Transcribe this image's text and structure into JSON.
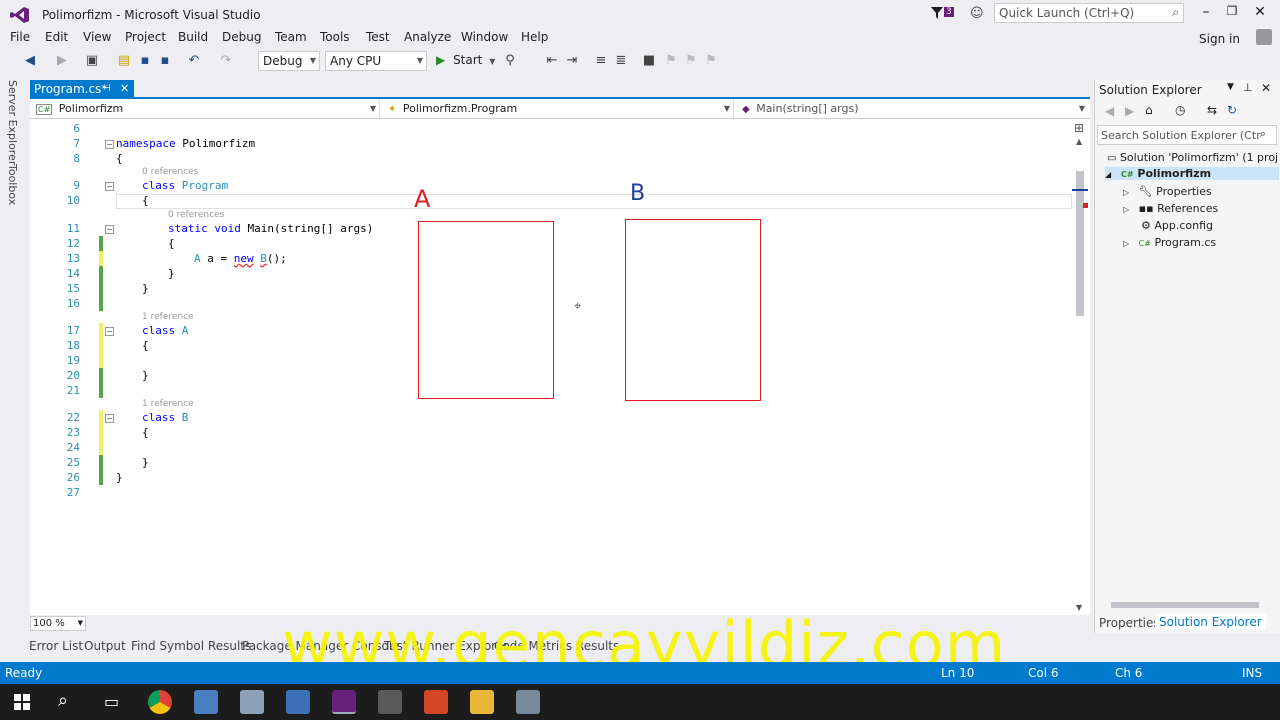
{
  "window": {
    "title": "Polimorfizm - Microsoft Visual Studio",
    "notification_count": "3",
    "quick_launch_placeholder": "Quick Launch (Ctrl+Q)"
  },
  "menu": [
    "File",
    "Edit",
    "View",
    "Project",
    "Build",
    "Debug",
    "Team",
    "Tools",
    "Test",
    "Analyze",
    "Window",
    "Help"
  ],
  "signin": "Sign in",
  "toolbar": {
    "config": "Debug",
    "platform": "Any CPU",
    "start": "Start"
  },
  "left_tabs": [
    "Server Explorer",
    "Toolbox"
  ],
  "document_tab": "Program.cs*",
  "navbar": {
    "project": "Polimorfizm",
    "type": "Polimorfizm.Program",
    "member": "Main(string[] args)"
  },
  "code": {
    "lines": [
      "6",
      "7",
      "8",
      "9",
      "10",
      "11",
      "12",
      "13",
      "14",
      "15",
      "16",
      "17",
      "18",
      "19",
      "20",
      "21",
      "22",
      "23",
      "24",
      "25",
      "26",
      "27"
    ],
    "ns_kw": "namespace",
    "ns_name": "Polimorfizm",
    "class_kw": "class",
    "program": "Program",
    "static_void": "static void",
    "main_sig": "Main(string[] args)",
    "decl_type": "A",
    "decl_rest": "a = ",
    "new_kw": "new",
    "new_type": "B",
    "new_end": "();",
    "class_a": "A",
    "class_b": "B",
    "open": "{",
    "close": "}",
    "lens_0ref": "0 references",
    "lens_1ref": "1 reference"
  },
  "drawing": {
    "label_a": "A",
    "label_b": "B"
  },
  "zoom": "100 %",
  "solution_explorer": {
    "title": "Solution Explorer",
    "search_placeholder": "Search Solution Explorer (Ctr",
    "items": [
      "Solution 'Polimorfizm' (1 proj",
      "Polimorfizm",
      "Properties",
      "References",
      "App.config",
      "Program.cs"
    ],
    "tab_properties": "Properties",
    "tab_solution": "Solution Explorer"
  },
  "bottom_tabs": [
    "Error List",
    "Output",
    "Find Symbol Results",
    "Package Manager Console",
    "Test Runner Explorer",
    "Code Metrics Results"
  ],
  "status": {
    "ready": "Ready",
    "ln": "Ln 10",
    "col": "Col 6",
    "ch": "Ch 6",
    "ins": "INS"
  },
  "watermark": "www.gencayyildiz.com",
  "colors": {
    "accent": "#007acc",
    "drawing": "#e02020",
    "watermark": "#f5f500",
    "vs_purple": "#68217a"
  }
}
